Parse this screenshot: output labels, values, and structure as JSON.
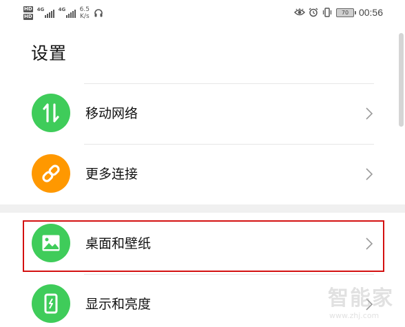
{
  "status_bar": {
    "hd1": "HD",
    "hd2": "HD",
    "net1": "4G",
    "net2": "4G",
    "speed_value": "6.5",
    "speed_unit": "K/s",
    "battery": "70",
    "time": "00:56"
  },
  "page": {
    "title": "设置"
  },
  "settings": [
    {
      "label": "移动网络",
      "icon": "data-arrows-icon",
      "color": "#3fcc5a"
    },
    {
      "label": "更多连接",
      "icon": "link-icon",
      "color": "#ff9800"
    },
    {
      "label": "桌面和壁纸",
      "icon": "image-icon",
      "color": "#3fcc5a"
    },
    {
      "label": "显示和亮度",
      "icon": "phone-brightness-icon",
      "color": "#3fcc5a"
    }
  ],
  "watermark": {
    "text": "智能家",
    "url": "www.zhj.com"
  },
  "colors": {
    "highlight_border": "#d30f0f",
    "section_gap": "#f0f0f0"
  }
}
